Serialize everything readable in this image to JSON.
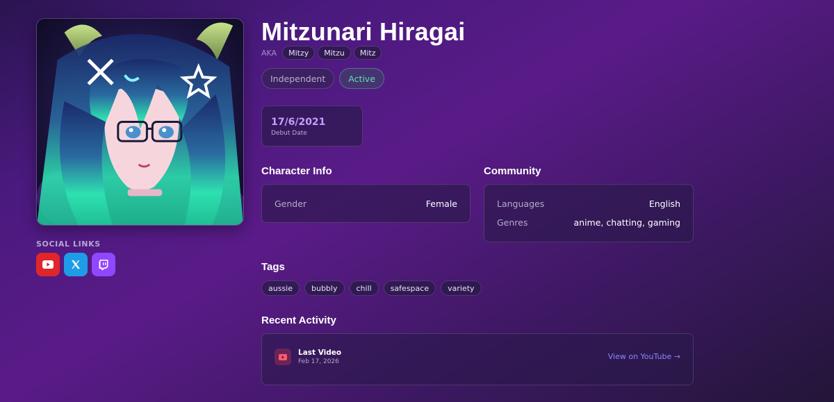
{
  "profile": {
    "name": "Mitzunari Hiragai",
    "aka_label": "AKA",
    "aliases": [
      "Mitzy",
      "Mitzu",
      "Mitz"
    ],
    "status_affiliation": "Independent",
    "status_activity": "Active"
  },
  "debut": {
    "value": "17/6/2021",
    "label": "Debut Date"
  },
  "social": {
    "title": "SOCIAL LINKS",
    "links": [
      {
        "icon": "youtube-icon",
        "color": "#e0262b"
      },
      {
        "icon": "x-icon",
        "color": "#1f9ce8"
      },
      {
        "icon": "twitch-icon",
        "color": "#9146ff"
      }
    ]
  },
  "character_info": {
    "title": "Character Info",
    "rows": [
      {
        "key": "Gender",
        "value": "Female"
      }
    ]
  },
  "community": {
    "title": "Community",
    "rows": [
      {
        "key": "Languages",
        "value": "English"
      },
      {
        "key": "Genres",
        "value": "anime, chatting, gaming"
      }
    ]
  },
  "tags": {
    "title": "Tags",
    "items": [
      "aussie",
      "bubbly",
      "chill",
      "safespace",
      "variety"
    ]
  },
  "recent_activity": {
    "title": "Recent Activity",
    "item_title": "Last Video",
    "item_date": "Feb 17, 2026",
    "link_label": "View on YouTube →"
  },
  "colors": {
    "accent_purple": "#c79cff",
    "active_green": "#5fe0a8",
    "link_blue": "#8a86ff"
  }
}
